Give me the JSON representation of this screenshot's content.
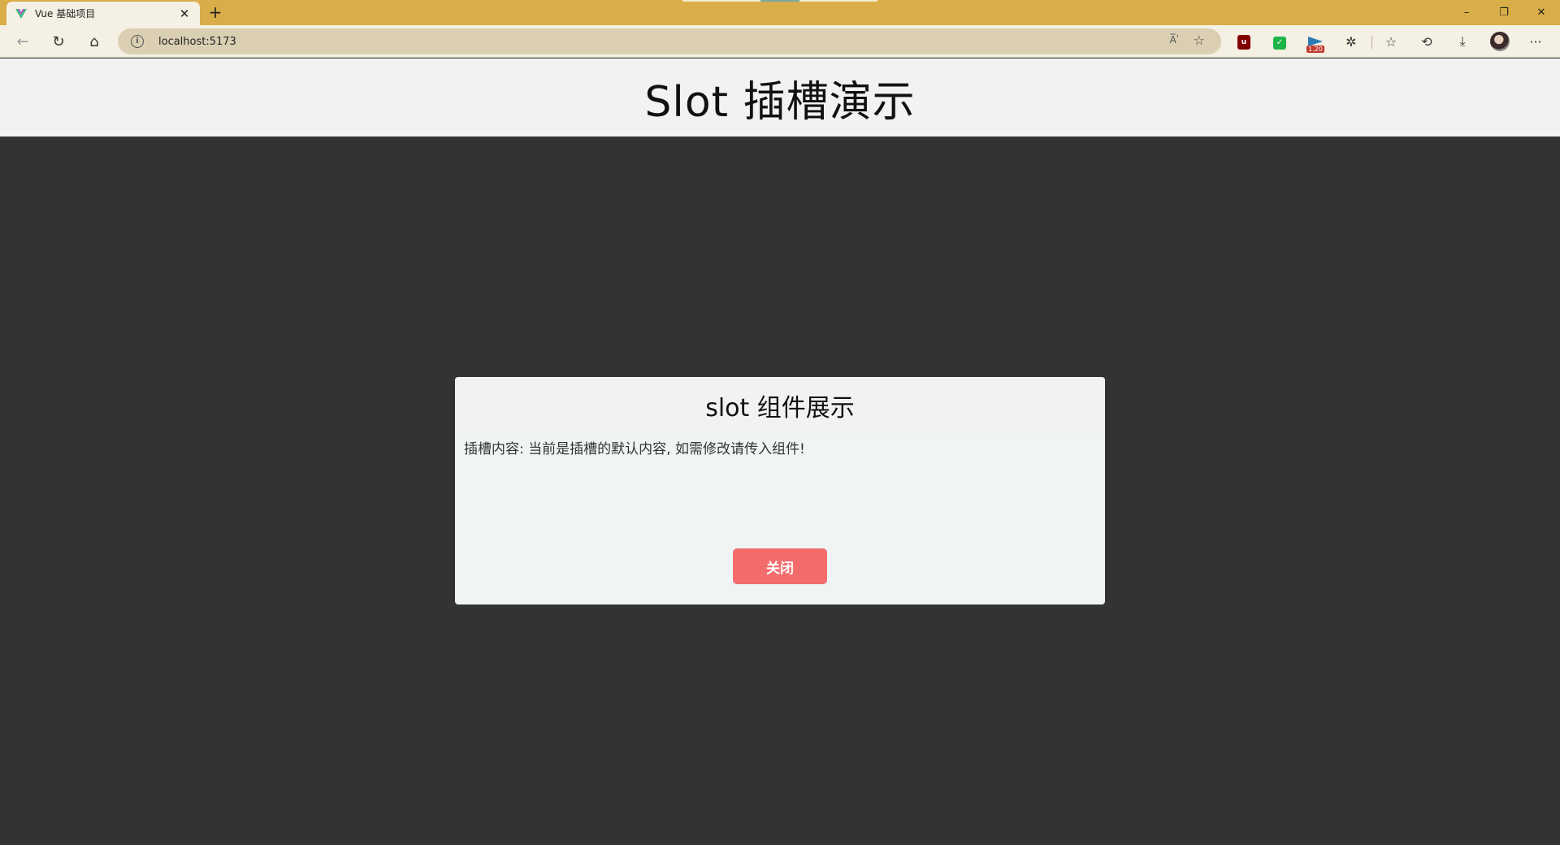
{
  "browser": {
    "tab": {
      "title": "Vue 基础项目",
      "close_glyph": "✕",
      "favicon": "vue-logo-icon"
    },
    "new_tab_glyph": "+",
    "window_controls": {
      "minimize": "–",
      "restore": "❐",
      "close": "✕"
    },
    "toolbar": {
      "back_glyph": "←",
      "reload_glyph": "↻",
      "home_glyph": "⌂",
      "address": "localhost:5173",
      "info_glyph": "i",
      "read_aloud_glyph": "A̅ʹ",
      "add_favorite_glyph": "☆",
      "extensions": {
        "ublock_label": "u",
        "green_ext_label": "✓",
        "badge_count": "1.20"
      },
      "puzzle_glyph": "✲",
      "favorites_glyph": "☆",
      "history_glyph": "⟲",
      "download_glyph": "⤓",
      "more_glyph": "···"
    }
  },
  "page": {
    "title": "Slot 插槽演示",
    "dialog": {
      "title": "slot 组件展示",
      "content": "插槽内容: 当前是插槽的默认内容, 如需修改请传入组件!",
      "close_label": "关闭"
    }
  },
  "colors": {
    "tabbar": "#d9ad48",
    "toolbar": "#f5f0e4",
    "backdrop": "#333333",
    "close_button": "#f26c6c"
  }
}
